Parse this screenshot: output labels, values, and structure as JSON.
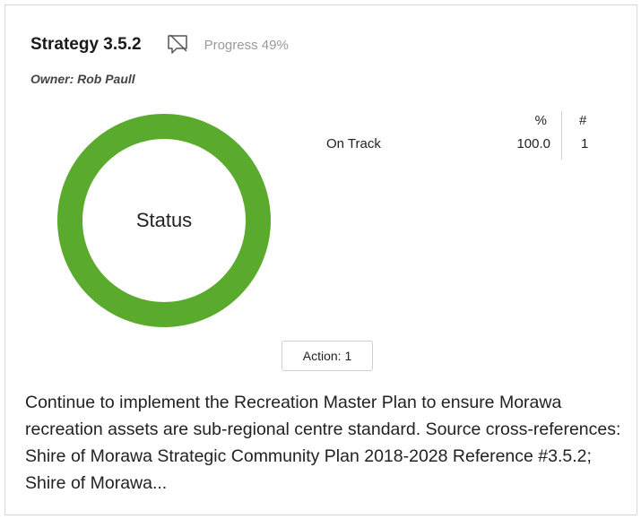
{
  "card": {
    "title": "Strategy 3.5.2",
    "comment_icon": "comment-off-icon",
    "progress": "Progress 49%",
    "owner": "Owner: Rob Paull"
  },
  "status_chart": {
    "center_label": "Status",
    "color": "#5aaa2e",
    "table": {
      "headers": {
        "pct": "%",
        "count": "#"
      },
      "rows": [
        {
          "label": "On Track",
          "pct": "100.0",
          "count": "1"
        }
      ]
    }
  },
  "action_button": {
    "label": "Action: 1"
  },
  "description": "Continue to implement the Recreation Master Plan to ensure Morawa recreation assets are sub-regional centre standard. Source cross-references: Shire of Morawa Strategic Community Plan 2018-2028 Reference #3.5.2; Shire of Morawa..."
}
